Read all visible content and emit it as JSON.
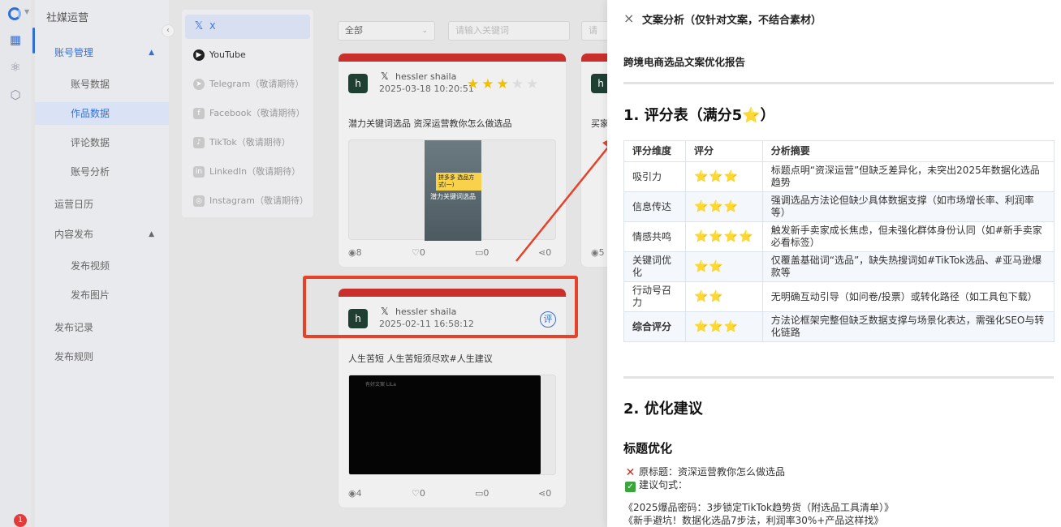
{
  "app": {
    "title": "社媒运营",
    "notification_count": "1"
  },
  "sidebar": {
    "groups": [
      {
        "label": "账号管理",
        "expanded": true,
        "items": [
          "账号数据",
          "作品数据",
          "评论数据",
          "账号分析"
        ]
      },
      {
        "label": "运营日历"
      },
      {
        "label": "内容发布",
        "expanded": true,
        "items": [
          "发布视频",
          "发布图片"
        ]
      },
      {
        "label": "发布记录"
      },
      {
        "label": "发布规则"
      }
    ],
    "selected": "作品数据"
  },
  "platforms": [
    {
      "label": "X",
      "active": true
    },
    {
      "label": "YouTube"
    },
    {
      "label": "Telegram（敬请期待）"
    },
    {
      "label": "Facebook（敬请期待）"
    },
    {
      "label": "TikTok（敬请期待）"
    },
    {
      "label": "LinkedIn（敬请期待）"
    },
    {
      "label": "Instagram（敬请期待）"
    }
  ],
  "filters": {
    "type_select": "全部",
    "keyword_placeholder": "请输入关键词",
    "extra_placeholder": "请"
  },
  "posts": [
    {
      "avatar": "h",
      "user": "hessler shaila",
      "date": "2025-03-18 10:20:51",
      "rating": 3,
      "text": "潜力关键词选品 资深运营教你怎么做选品",
      "thumb_caption": "拼多多 选品方式(一)",
      "thumb_subtitle": "潜力关键词选品",
      "views": "8",
      "likes": "0",
      "comments": "0",
      "shares": "0"
    },
    {
      "avatar": "h",
      "user": "hessler shaila",
      "date": "2025-02-11 16:58:12",
      "rate_label": "评",
      "text": "人生苦短 人生苦短须尽欢#人生建议",
      "video_watermark": "有好文案 LiLa",
      "views": "4",
      "likes": "0",
      "comments": "0",
      "shares": "0"
    },
    {
      "avatar": "h",
      "text": "买家",
      "views": "5"
    }
  ],
  "drawer": {
    "close_icon": "×",
    "title": "文案分析（仅针对文案，不结合素材）",
    "report_title": "跨境电商选品文案优化报告",
    "section1": "1. 评分表（满分5",
    "section1_star": "⭐",
    "section1_end": "）",
    "table": {
      "headers": [
        "评分维度",
        "评分",
        "分析摘要"
      ],
      "rows": [
        {
          "dim": "吸引力",
          "stars": "⭐⭐⭐",
          "summary": "标题点明“资深运营”但缺乏差异化，未突出2025年数据化选品趋势"
        },
        {
          "dim": "信息传达",
          "stars": "⭐⭐⭐",
          "summary": "强调选品方法论但缺少具体数据支撑（如市场增长率、利润率等）"
        },
        {
          "dim": "情感共鸣",
          "stars": "⭐⭐⭐⭐",
          "summary": "触发新手卖家成长焦虑，但未强化群体身份认同（如#新手卖家必看标签）"
        },
        {
          "dim": "关键词优化",
          "stars": "⭐⭐",
          "summary": "仅覆盖基础词“选品”，缺失热搜词如#TikTok选品、#亚马逊爆款等"
        },
        {
          "dim": "行动号召力",
          "stars": "⭐⭐",
          "summary": "无明确互动引导（如问卷/投票）或转化路径（如工具包下载）"
        },
        {
          "dim": "综合评分",
          "stars": "⭐⭐⭐",
          "summary": "方法论框架完整但缺乏数据支撑与场景化表达，需强化SEO与转化链路",
          "bold": true
        }
      ]
    },
    "section2": "2. 优化建议",
    "subsection": "标题优化",
    "original_title": "原标题：资深运营教你怎么做选品",
    "suggest_label": "建议句式：",
    "suggestions": [
      "《2025爆品密码：3步锁定TikTok趋势货（附选品工具清单）》",
      "《新手避坑！数据化选品7步法，利润率30%+产品这样找》"
    ]
  }
}
